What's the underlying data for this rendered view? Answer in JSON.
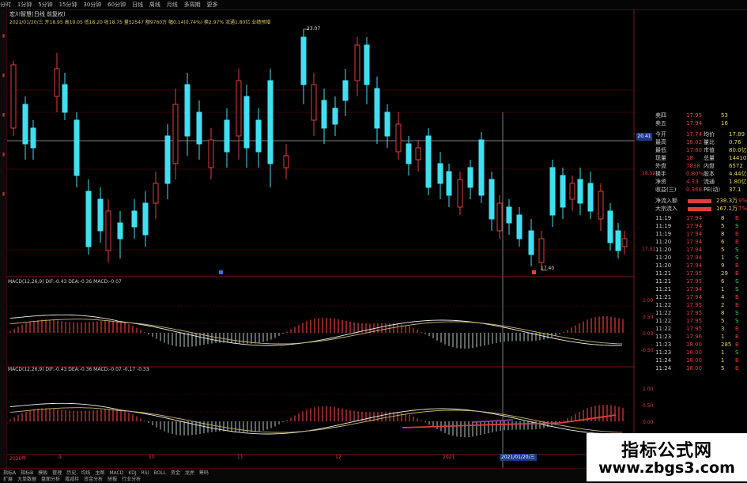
{
  "top_toolbar": {
    "items": [
      "分时",
      "1分钟",
      "5分钟",
      "15分钟",
      "30分钟",
      "60分钟",
      "日线",
      "周线",
      "月线",
      "多周期",
      "更多"
    ]
  },
  "chart_header": {
    "title": "宏川智慧(日线 前复权)",
    "info_line": "2021/01/20/三 开18.95 高19.05 低18.20 收18.75 量52547 额9760万 幅0.14(0.74%) 换2.97% 流通1.80亿 业绩预增"
  },
  "price_labels": {
    "high_mark": "23.07",
    "low_mark": "17.40",
    "crosshair_price": "20.41",
    "right_1": "18.59",
    "right_2": "17.31"
  },
  "macd1": {
    "label": "MACD(12,26,9) DIF:-0.43 DEA:-0.36 MACD:-0.07",
    "axis": [
      "1.00",
      "0.50",
      "0.00",
      "-0.50"
    ]
  },
  "macd2": {
    "label": "MACD(12,26,9) DIF:-0.43 DEA:-0.36 MACD:-0.07 -0.17 -0.33",
    "axis": [
      "1.00",
      "0.50",
      "0.00",
      "-0.50"
    ]
  },
  "x_axis": {
    "labels": [
      "2020年",
      "9",
      "10",
      "11",
      "12",
      "2021",
      "2021/01/20/三"
    ]
  },
  "quote_panel": {
    "order_book": [
      {
        "label": "卖四",
        "price": "17.95",
        "vol": "53"
      },
      {
        "label": "卖五",
        "price": "17.94",
        "vol": "16"
      }
    ],
    "stats": [
      {
        "k1": "今开",
        "v1": "17.74",
        "k2": "均价",
        "v2": "17.89"
      },
      {
        "k1": "最高",
        "v1": "18.02",
        "k2": "量比",
        "v2": "0.76"
      },
      {
        "k1": "最低",
        "v1": "17.60",
        "k2": "市值",
        "v2": "80.0亿"
      },
      {
        "k1": "现量",
        "v1": "18",
        "k2": "总量",
        "v2": "14410"
      },
      {
        "k1": "外盘",
        "v1": "7838",
        "k2": "内盘",
        "v2": "6572"
      },
      {
        "k1": "换手",
        "v1": "0.80%",
        "k2": "股本",
        "v2": "4.44亿"
      },
      {
        "k1": "净资",
        "v1": "4.33",
        "k2": "流通",
        "v2": "1.80亿"
      },
      {
        "k1": "收益(三)",
        "v1": "0.368",
        "k2": "PE(动)",
        "v2": "37.1"
      }
    ],
    "flows": [
      {
        "label": "净流入额",
        "value": "238.3万",
        "pct": "9%"
      },
      {
        "label": "大宗流入",
        "value": "167.1万",
        "pct": "7%"
      }
    ],
    "ticks": [
      {
        "t": "11:19",
        "p": "17.94",
        "v": "8",
        "d": "B"
      },
      {
        "t": "11:19",
        "p": "17.94",
        "v": "5",
        "d": "S"
      },
      {
        "t": "11:19",
        "p": "17.94",
        "v": "8",
        "d": "B"
      },
      {
        "t": "11:20",
        "p": "17.94",
        "v": "6",
        "d": "B"
      },
      {
        "t": "11:20",
        "p": "17.94",
        "v": "5",
        "d": "S"
      },
      {
        "t": "11:20",
        "p": "17.94",
        "v": "1",
        "d": "S"
      },
      {
        "t": "11:20",
        "p": "17.94",
        "v": "9",
        "d": "B"
      },
      {
        "t": "11:21",
        "p": "17.95",
        "v": "29",
        "d": "B"
      },
      {
        "t": "11:21",
        "p": "17.95",
        "v": "6",
        "d": "S"
      },
      {
        "t": "11:21",
        "p": "17.94",
        "v": "1",
        "d": "S"
      },
      {
        "t": "11:21",
        "p": "17.94",
        "v": "4",
        "d": "B"
      },
      {
        "t": "11:22",
        "p": "17.95",
        "v": "2",
        "d": "B"
      },
      {
        "t": "11:22",
        "p": "17.95",
        "v": "8",
        "d": "S"
      },
      {
        "t": "11:22",
        "p": "17.95",
        "v": "5",
        "d": "S"
      },
      {
        "t": "11:22",
        "p": "17.95",
        "v": "3",
        "d": "B"
      },
      {
        "t": "11:23",
        "p": "17.96",
        "v": "1",
        "d": "B"
      },
      {
        "t": "11:23",
        "p": "18.00",
        "v": "285",
        "d": "B"
      },
      {
        "t": "11:23",
        "p": "18.00",
        "v": "1",
        "d": "S"
      },
      {
        "t": "11:24",
        "p": "18.00",
        "v": "1",
        "d": "B"
      },
      {
        "t": "11:24",
        "p": "18.00",
        "v": "5",
        "d": "B"
      }
    ]
  },
  "bottom_bar": {
    "row1": [
      "指标A",
      "指标B",
      "模板",
      "管理",
      "历史",
      "均线",
      "主图",
      "MACD",
      "KDJ",
      "RSI",
      "BOLL",
      "资金",
      "龙虎",
      "筹码"
    ],
    "row2": [
      "扩展",
      "大单数据",
      "盘面分析",
      "增减持",
      "资金分析",
      "研报",
      "行业分析"
    ]
  },
  "watermark": {
    "title": "指标公式网",
    "url": "www.zbgs3.com"
  },
  "colors": {
    "up": "#e23c3c",
    "down": "#3fe0f0",
    "grid": "#6a0a0a",
    "ma": "#e8e8e8"
  }
}
